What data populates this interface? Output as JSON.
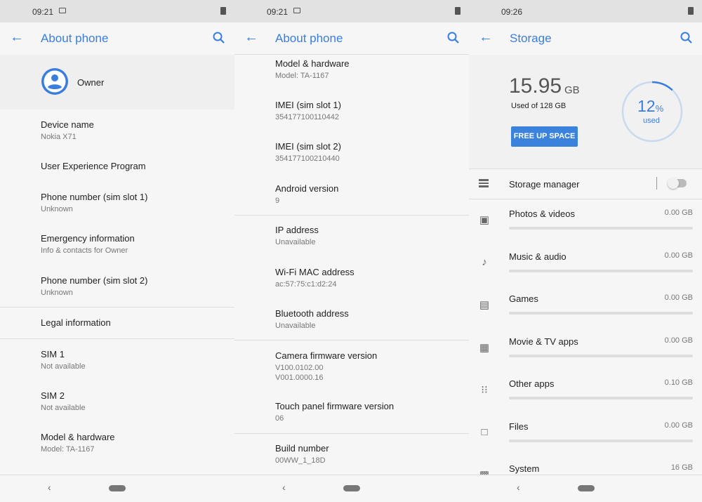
{
  "panels": [
    {
      "time": "09:21",
      "title": "About phone",
      "owner": "Owner",
      "items": [
        {
          "title": "Device name",
          "sub": "Nokia X71"
        },
        {
          "title": "User Experience Program",
          "sub": ""
        },
        {
          "title": "Phone number (sim slot 1)",
          "sub": "Unknown"
        },
        {
          "title": "Emergency information",
          "sub": "Info & contacts for Owner"
        },
        {
          "title": "Phone number (sim slot 2)",
          "sub": "Unknown"
        },
        {
          "title": "Legal information",
          "sub": ""
        },
        {
          "title": "SIM 1",
          "sub": "Not available"
        },
        {
          "title": "SIM 2",
          "sub": "Not available"
        },
        {
          "title": "Model & hardware",
          "sub": "Model: TA-1167"
        }
      ]
    },
    {
      "time": "09:21",
      "title": "About phone",
      "items": [
        {
          "title": "Model & hardware",
          "sub": "Model: TA-1167"
        },
        {
          "title": "IMEI (sim slot 1)",
          "sub": "354177100110442"
        },
        {
          "title": "IMEI (sim slot 2)",
          "sub": "354177100210440"
        },
        {
          "title": "Android version",
          "sub": "9"
        },
        {
          "title": "IP address",
          "sub": "Unavailable"
        },
        {
          "title": "Wi-Fi MAC address",
          "sub": "ac:57:75:c1:d2:24"
        },
        {
          "title": "Bluetooth address",
          "sub": "Unavailable"
        },
        {
          "title": "Camera firmware version",
          "sub": "V100.0102.00\nV001.0000.16"
        },
        {
          "title": "Touch panel firmware version",
          "sub": "06"
        },
        {
          "title": "Build number",
          "sub": "00WW_1_18D"
        }
      ]
    },
    {
      "time": "09:26",
      "title": "Storage",
      "used_value": "15.95",
      "used_unit": "GB",
      "used_of": "Used of 128 GB",
      "free_button": "FREE UP SPACE",
      "percent": "12",
      "percent_sign": "%",
      "percent_label": "used",
      "percent_fraction": 0.12,
      "storage_manager": "Storage manager",
      "storage_manager_on": false,
      "categories": [
        {
          "label": "Photos & videos",
          "size": "0.00 GB",
          "icon": "photos-icon"
        },
        {
          "label": "Music & audio",
          "size": "0.00 GB",
          "icon": "music-note-icon"
        },
        {
          "label": "Games",
          "size": "0.00 GB",
          "icon": "gamepad-icon"
        },
        {
          "label": "Movie & TV apps",
          "size": "0.00 GB",
          "icon": "movie-icon"
        },
        {
          "label": "Other apps",
          "size": "0.10 GB",
          "icon": "apps-grid-icon"
        },
        {
          "label": "Files",
          "size": "0.00 GB",
          "icon": "folder-icon"
        },
        {
          "label": "System",
          "size": "16 GB",
          "icon": "system-icon"
        }
      ]
    }
  ],
  "colors": {
    "accent": "#3b7ddd",
    "button": "#3b82dc"
  }
}
